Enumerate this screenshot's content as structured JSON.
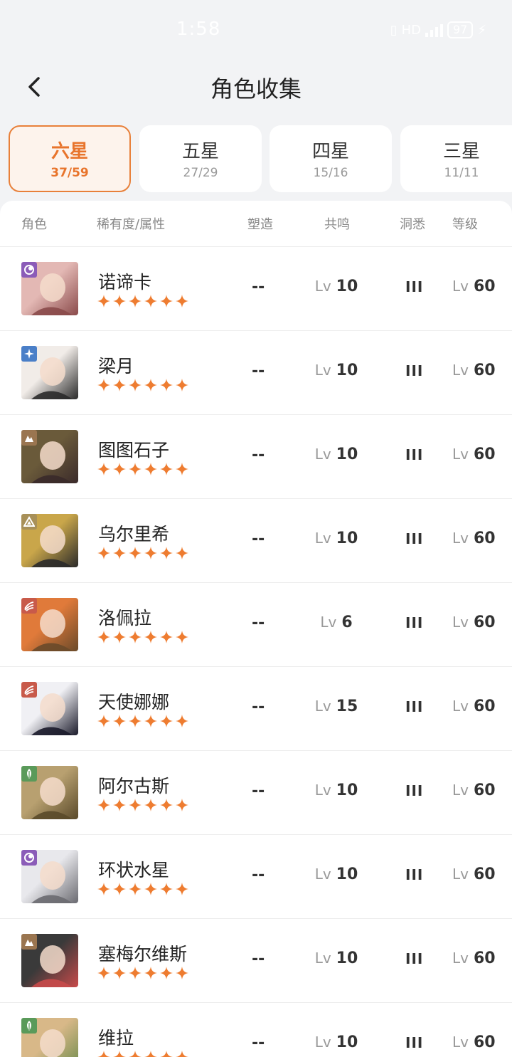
{
  "status_bar": {
    "time": "1:58",
    "signal": "HD",
    "battery": "97"
  },
  "header": {
    "title": "角色收集"
  },
  "tabs": [
    {
      "label": "六星",
      "count": "37/59",
      "active": true
    },
    {
      "label": "五星",
      "count": "27/29",
      "active": false
    },
    {
      "label": "四星",
      "count": "15/16",
      "active": false
    },
    {
      "label": "三星",
      "count": "11/11",
      "active": false
    }
  ],
  "table_header": {
    "character": "角色",
    "rarity": "稀有度/属性",
    "mold": "塑造",
    "resonance": "共鸣",
    "insight": "洞悉",
    "level": "等级"
  },
  "colors": {
    "accent": "#e8742c",
    "star": "#ee7c30",
    "attr_purple": "#8b5cb8",
    "attr_blue": "#4a7fc8",
    "attr_brown": "#9a7550",
    "attr_gold": "#a89058",
    "attr_red": "#c85a4a",
    "attr_green": "#5a9a5a"
  },
  "characters": [
    {
      "name": "诺谛卡",
      "attr_icon": "moon-icon",
      "attr_color": "#8b5cb8",
      "avatar_colors": [
        "#e3b8b4",
        "#8a4a4a"
      ],
      "stars": 6,
      "mold": "--",
      "res_prefix": "Lv",
      "resonance": "10",
      "insight": "III",
      "lvl_prefix": "Lv",
      "level": "60"
    },
    {
      "name": "梁月",
      "attr_icon": "star-icon",
      "attr_color": "#4a7fc8",
      "avatar_colors": [
        "#f1ece8",
        "#2a2a2a"
      ],
      "stars": 6,
      "mold": "--",
      "res_prefix": "Lv",
      "resonance": "10",
      "insight": "III",
      "lvl_prefix": "Lv",
      "level": "60"
    },
    {
      "name": "图图石子",
      "attr_icon": "mountain-icon",
      "attr_color": "#9a7550",
      "avatar_colors": [
        "#6a5a3a",
        "#3a2a2a"
      ],
      "stars": 6,
      "mold": "--",
      "res_prefix": "Lv",
      "resonance": "10",
      "insight": "III",
      "lvl_prefix": "Lv",
      "level": "60"
    },
    {
      "name": "乌尔里希",
      "attr_icon": "triangle-icon",
      "attr_color": "#a89058",
      "avatar_colors": [
        "#c9a64a",
        "#2a2a2a"
      ],
      "stars": 6,
      "mold": "--",
      "res_prefix": "Lv",
      "resonance": "10",
      "insight": "III",
      "lvl_prefix": "Lv",
      "level": "60"
    },
    {
      "name": "洛佩拉",
      "attr_icon": "claw-icon",
      "attr_color": "#c85a4a",
      "avatar_colors": [
        "#e07a3a",
        "#6a4a2a"
      ],
      "stars": 6,
      "mold": "--",
      "res_prefix": "Lv",
      "resonance": "6",
      "insight": "III",
      "lvl_prefix": "Lv",
      "level": "60"
    },
    {
      "name": "天使娜娜",
      "attr_icon": "claw-icon",
      "attr_color": "#c85a4a",
      "avatar_colors": [
        "#f0f0f4",
        "#1a1a2a"
      ],
      "stars": 6,
      "mold": "--",
      "res_prefix": "Lv",
      "resonance": "15",
      "insight": "III",
      "lvl_prefix": "Lv",
      "level": "60"
    },
    {
      "name": "阿尔古斯",
      "attr_icon": "leaf-icon",
      "attr_color": "#5a9a5a",
      "avatar_colors": [
        "#b8a070",
        "#5a4a2a"
      ],
      "stars": 6,
      "mold": "--",
      "res_prefix": "Lv",
      "resonance": "10",
      "insight": "III",
      "lvl_prefix": "Lv",
      "level": "60"
    },
    {
      "name": "环状水星",
      "attr_icon": "moon-icon",
      "attr_color": "#8b5cb8",
      "avatar_colors": [
        "#e8e8ec",
        "#6a6a70"
      ],
      "stars": 6,
      "mold": "--",
      "res_prefix": "Lv",
      "resonance": "10",
      "insight": "III",
      "lvl_prefix": "Lv",
      "level": "60"
    },
    {
      "name": "塞梅尔维斯",
      "attr_icon": "mountain-icon",
      "attr_color": "#9a7550",
      "avatar_colors": [
        "#3a3a3a",
        "#c84a4a"
      ],
      "stars": 6,
      "mold": "--",
      "res_prefix": "Lv",
      "resonance": "10",
      "insight": "III",
      "lvl_prefix": "Lv",
      "level": "60"
    },
    {
      "name": "维拉",
      "attr_icon": "leaf-icon",
      "attr_color": "#5a9a5a",
      "avatar_colors": [
        "#d8b888",
        "#6a8a4a"
      ],
      "stars": 6,
      "mold": "--",
      "res_prefix": "Lv",
      "resonance": "10",
      "insight": "III",
      "lvl_prefix": "Lv",
      "level": "60"
    }
  ]
}
